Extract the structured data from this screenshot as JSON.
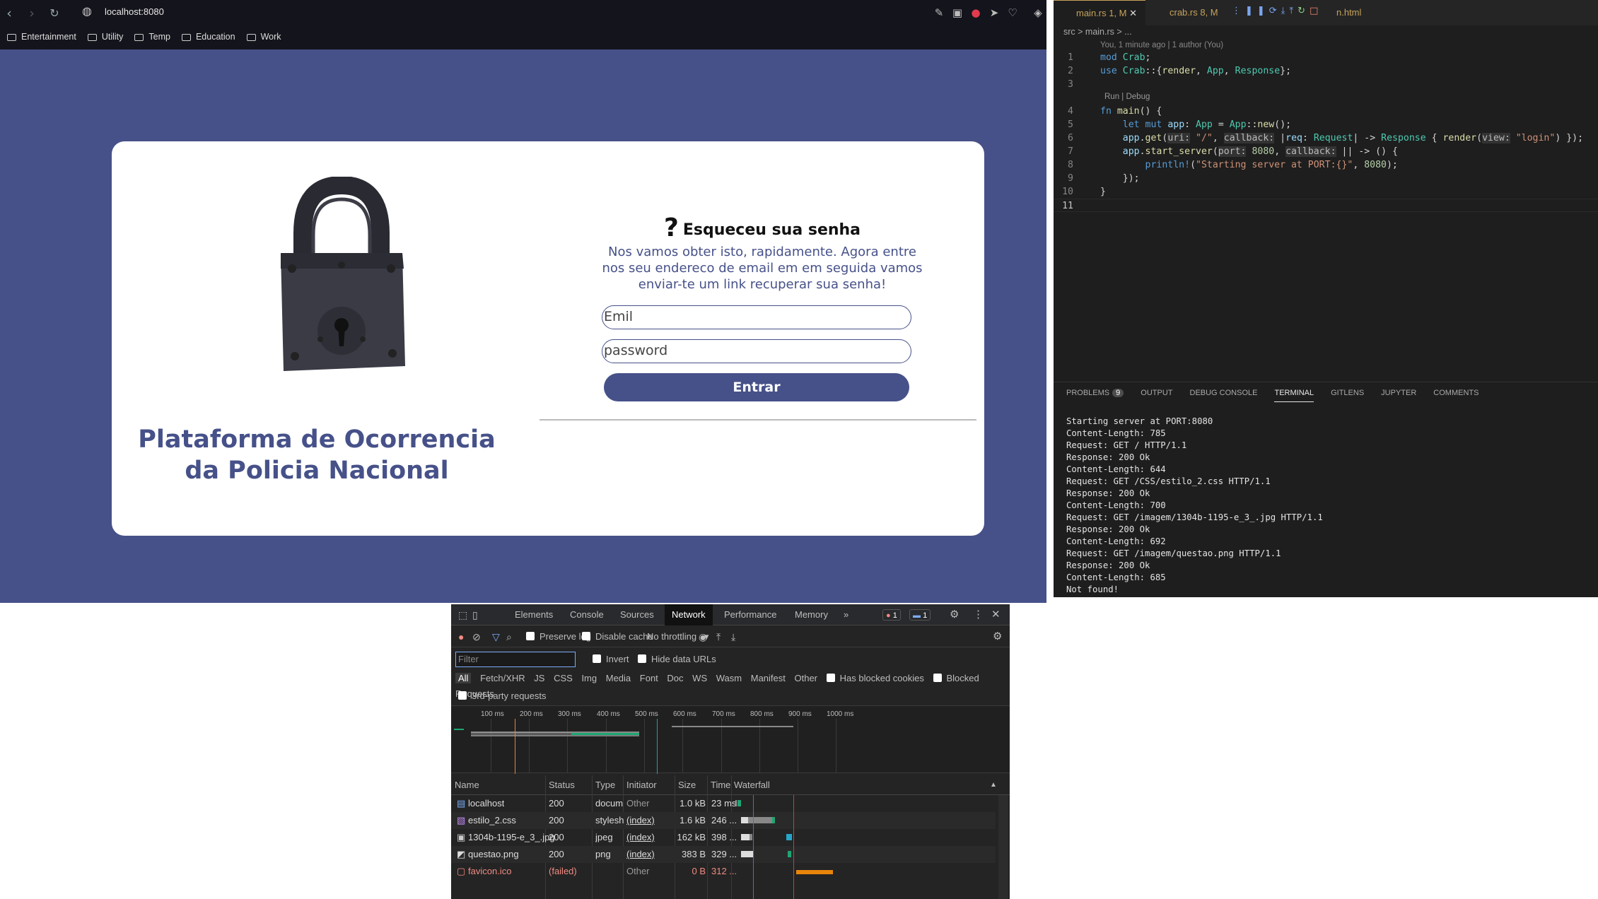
{
  "browser": {
    "url": "localhost:8080",
    "bookmarks": [
      "Entertainment",
      "Utility",
      "Temp",
      "Education",
      "Work"
    ]
  },
  "page": {
    "brand_title": "Plataforma de Ocorrencia da Policia Nacional",
    "question_mark": "?",
    "heading": "Esqueceu sua senha",
    "subtitle": "Nos vamos obter isto, rapidamente. Agora entre nos seu endereco de email em em seguida vamos enviar-te um link recuperar sua senha!",
    "email_placeholder": "Emil",
    "password_placeholder": "password",
    "submit_label": "Entrar",
    "colors": {
      "primary": "#465189",
      "card": "#ffffff"
    }
  },
  "editor": {
    "tabs": [
      {
        "label": "main.rs 1, M",
        "active": true
      },
      {
        "label": "crab.rs 8, M",
        "active": false
      },
      {
        "label": "n.html",
        "active": false
      }
    ],
    "breadcrumb": "src > main.rs > ...",
    "blame": "You, 1 minute ago | 1 author (You)",
    "run_debug": "Run | Debug",
    "line_numbers": [
      "1",
      "2",
      "3",
      "4",
      "5",
      "6",
      "7",
      "8",
      "9",
      "10",
      "11"
    ],
    "panel_tabs": [
      "PROBLEMS",
      "OUTPUT",
      "DEBUG CONSOLE",
      "TERMINAL",
      "GITLENS",
      "JUPYTER",
      "COMMENTS"
    ],
    "problems_count": "9",
    "active_panel": "TERMINAL",
    "terminal_lines": [
      "Starting server at PORT:8080",
      "Content-Length: 785",
      "Request: GET / HTTP/1.1",
      "Response: 200 Ok",
      "Content-Length: 644",
      "Request: GET /CSS/estilo_2.css HTTP/1.1",
      "Response: 200 Ok",
      "Content-Length: 700",
      "Request: GET /imagem/1304b-1195-e_3_.jpg HTTP/1.1",
      "Response: 200 Ok",
      "Content-Length: 692",
      "Request: GET /imagem/questao.png HTTP/1.1",
      "Response: 200 Ok",
      "Content-Length: 685",
      "Not found!"
    ]
  },
  "devtools": {
    "tabs": [
      "Elements",
      "Console",
      "Sources",
      "Network",
      "Performance",
      "Memory"
    ],
    "active_tab": "Network",
    "error_count": "1",
    "message_count": "1",
    "preserve_log": "Preserve log",
    "disable_cache": "Disable cache",
    "throttling": "No throttling",
    "filter_placeholder": "Filter",
    "invert": "Invert",
    "hide_data_urls": "Hide data URLs",
    "type_filters": [
      "All",
      "Fetch/XHR",
      "JS",
      "CSS",
      "Img",
      "Media",
      "Font",
      "Doc",
      "WS",
      "Wasm",
      "Manifest",
      "Other"
    ],
    "has_blocked_cookies": "Has blocked cookies",
    "blocked_requests": "Blocked Requests",
    "third_party": "3rd-party requests",
    "timeline_ticks": [
      "100 ms",
      "200 ms",
      "300 ms",
      "400 ms",
      "500 ms",
      "600 ms",
      "700 ms",
      "800 ms",
      "900 ms",
      "1000 ms"
    ],
    "columns": [
      "Name",
      "Status",
      "Type",
      "Initiator",
      "Size",
      "Time",
      "Waterfall"
    ],
    "rows": [
      {
        "name": "localhost",
        "status": "200",
        "type": "docum...",
        "initiator": "Other",
        "size": "1.0 kB",
        "time": "23 ms",
        "failed": false
      },
      {
        "name": "estilo_2.css",
        "status": "200",
        "type": "stylesh...",
        "initiator": "(index)",
        "size": "1.6 kB",
        "time": "246 ...",
        "failed": false
      },
      {
        "name": "1304b-1195-e_3_.jpg",
        "status": "200",
        "type": "jpeg",
        "initiator": "(index)",
        "size": "162 kB",
        "time": "398 ...",
        "failed": false
      },
      {
        "name": "questao.png",
        "status": "200",
        "type": "png",
        "initiator": "(index)",
        "size": "383 B",
        "time": "329 ...",
        "failed": false
      },
      {
        "name": "favicon.ico",
        "status": "(failed)",
        "type": "",
        "initiator": "Other",
        "size": "0 B",
        "time": "312 ...",
        "failed": true
      }
    ]
  }
}
